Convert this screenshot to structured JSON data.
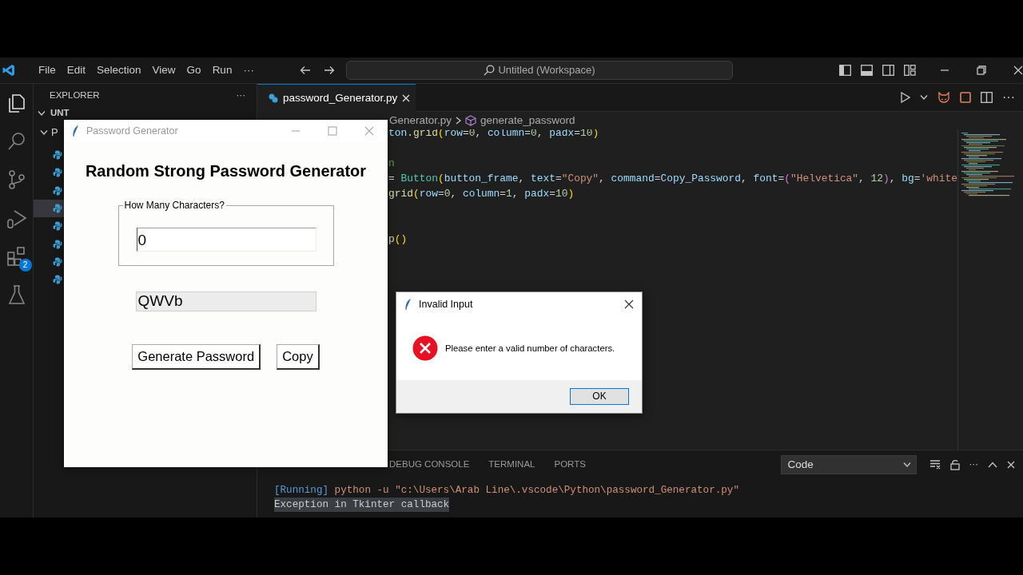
{
  "title_bar": {
    "menu": [
      "File",
      "Edit",
      "Selection",
      "View",
      "Go",
      "Run"
    ],
    "more": "···",
    "search": "Untitled (Workspace)"
  },
  "activity_bar": [
    {
      "kind": "explorer",
      "selected": true
    },
    {
      "kind": "search",
      "selected": false
    },
    {
      "kind": "source-control",
      "selected": false
    },
    {
      "kind": "run-debug",
      "selected": false
    },
    {
      "kind": "extensions",
      "selected": false,
      "badge": "2"
    },
    {
      "kind": "testing",
      "selected": false
    }
  ],
  "sidebar": {
    "title": "EXPLORER",
    "more": "···",
    "workspace": "UNT",
    "folder": "P",
    "files": [
      {
        "selected": false
      },
      {
        "selected": false
      },
      {
        "selected": false
      },
      {
        "selected": true
      },
      {
        "selected": false
      },
      {
        "selected": false
      },
      {
        "selected": false
      },
      {
        "selected": false
      }
    ]
  },
  "editor": {
    "tabs": [
      {
        "label": "password_Generator.py",
        "selected": true
      }
    ],
    "more": "···",
    "breadcrumb": {
      "file": "Generator.py",
      "symbol": "generate_password"
    },
    "code_lines": [
      {
        "kind": "code",
        "tokens": [
          {
            "text": "ton",
            "kind": "var"
          },
          {
            "text": ".",
            "kind": "punc"
          },
          {
            "text": "grid",
            "kind": "fn"
          },
          {
            "text": "(",
            "kind": "bracket"
          },
          {
            "text": "row",
            "kind": "var"
          },
          {
            "text": "=",
            "kind": "punc"
          },
          {
            "text": "0",
            "kind": "num"
          },
          {
            "text": ", ",
            "kind": "punc"
          },
          {
            "text": "column",
            "kind": "var"
          },
          {
            "text": "=",
            "kind": "punc"
          },
          {
            "text": "0",
            "kind": "num"
          },
          {
            "text": ", ",
            "kind": "punc"
          },
          {
            "text": "padx",
            "kind": "var"
          },
          {
            "text": "=",
            "kind": "punc"
          },
          {
            "text": "10",
            "kind": "num"
          },
          {
            "text": ")",
            "kind": "bracket"
          }
        ]
      },
      {
        "kind": "blank"
      },
      {
        "kind": "code",
        "tokens": [
          {
            "text": "n",
            "kind": "comment"
          }
        ]
      },
      {
        "kind": "code",
        "tokens": [
          {
            "text": "= ",
            "kind": "punc"
          },
          {
            "text": "Button",
            "kind": "cls"
          },
          {
            "text": "(",
            "kind": "bracket"
          },
          {
            "text": "button_frame",
            "kind": "var"
          },
          {
            "text": ", ",
            "kind": "punc"
          },
          {
            "text": "text",
            "kind": "var"
          },
          {
            "text": "=",
            "kind": "punc"
          },
          {
            "text": "\"Copy\"",
            "kind": "str"
          },
          {
            "text": ", ",
            "kind": "punc"
          },
          {
            "text": "command",
            "kind": "var"
          },
          {
            "text": "=",
            "kind": "punc"
          },
          {
            "text": "Copy_Password",
            "kind": "var"
          },
          {
            "text": ", ",
            "kind": "punc"
          },
          {
            "text": "font",
            "kind": "var"
          },
          {
            "text": "=",
            "kind": "punc"
          },
          {
            "text": "(",
            "kind": "bracket2"
          },
          {
            "text": "\"Helvetica\"",
            "kind": "str"
          },
          {
            "text": ", ",
            "kind": "punc"
          },
          {
            "text": "12",
            "kind": "num"
          },
          {
            "text": ")",
            "kind": "bracket2"
          },
          {
            "text": ", ",
            "kind": "punc"
          },
          {
            "text": "bg",
            "kind": "var"
          },
          {
            "text": "=",
            "kind": "punc"
          },
          {
            "text": "'white",
            "kind": "str"
          }
        ]
      },
      {
        "kind": "code",
        "tokens": [
          {
            "text": "grid",
            "kind": "fn"
          },
          {
            "text": "(",
            "kind": "bracket"
          },
          {
            "text": "row",
            "kind": "var"
          },
          {
            "text": "=",
            "kind": "punc"
          },
          {
            "text": "0",
            "kind": "num"
          },
          {
            "text": ", ",
            "kind": "punc"
          },
          {
            "text": "column",
            "kind": "var"
          },
          {
            "text": "=",
            "kind": "punc"
          },
          {
            "text": "1",
            "kind": "num"
          },
          {
            "text": ", ",
            "kind": "punc"
          },
          {
            "text": "padx",
            "kind": "var"
          },
          {
            "text": "=",
            "kind": "punc"
          },
          {
            "text": "10",
            "kind": "num"
          },
          {
            "text": ")",
            "kind": "bracket"
          }
        ]
      },
      {
        "kind": "blank"
      },
      {
        "kind": "blank"
      },
      {
        "kind": "code",
        "tokens": [
          {
            "text": "p",
            "kind": "fn"
          },
          {
            "text": "()",
            "kind": "bracket"
          }
        ]
      }
    ]
  },
  "panel": {
    "tabs": [
      {
        "label": "DEBUG CONSOLE",
        "selected": false
      },
      {
        "label": "TERMINAL",
        "selected": false
      },
      {
        "label": "PORTS",
        "selected": false
      }
    ],
    "dropdown": "Code",
    "more": "···",
    "output": [
      {
        "highlighted": false,
        "tokens": [
          {
            "text": "[Running]",
            "kind": "info"
          },
          {
            "text": " python -u \"c:\\Users\\Arab Line\\.vscode\\Python\\password_Generator.py\"",
            "kind": "str"
          }
        ]
      },
      {
        "highlighted": true,
        "tokens": [
          {
            "text": "Exception in Tkinter callback",
            "kind": "plain"
          }
        ]
      }
    ]
  },
  "tk_window": {
    "title": "Password Generator",
    "heading": "Random Strong Password Generator",
    "frame_label": "How Many Characters?",
    "char_count": "0",
    "password": "QWVb",
    "buttons": [
      "Generate Password",
      "Copy"
    ]
  },
  "dialog": {
    "title": "Invalid Input",
    "message": "Please enter a valid number of characters.",
    "button": "OK"
  }
}
